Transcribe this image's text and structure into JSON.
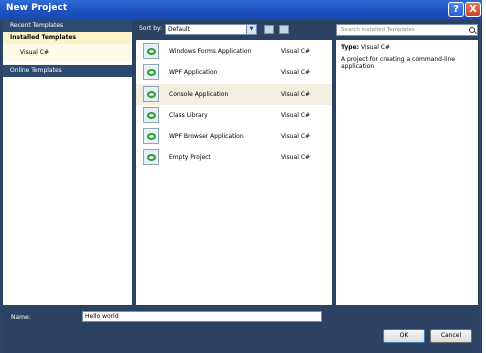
{
  "window": {
    "title": "New Project"
  },
  "left": {
    "recent": "Recent Templates",
    "installed": "Installed Templates",
    "language": "Visual C#",
    "online": "Online Templates"
  },
  "sort": {
    "label": "Sort by:",
    "selected": "Default"
  },
  "search": {
    "placeholder": "Search Installed Templates"
  },
  "templates": [
    {
      "name": "Windows Forms Application",
      "lang": "Visual C#"
    },
    {
      "name": "WPF Application",
      "lang": "Visual C#"
    },
    {
      "name": "Console Application",
      "lang": "Visual C#",
      "selected": true
    },
    {
      "name": "Class Library",
      "lang": "Visual C#"
    },
    {
      "name": "WPF Browser Application",
      "lang": "Visual C#"
    },
    {
      "name": "Empty Project",
      "lang": "Visual C#"
    }
  ],
  "details": {
    "type_label": "Type:",
    "type_value": "Visual C#",
    "description": "A project for creating a command-line application"
  },
  "name_field": {
    "label": "Name:",
    "value": "Hello world"
  },
  "buttons": {
    "ok": "OK",
    "cancel": "Cancel"
  },
  "icons": {
    "help": "?",
    "close": "X",
    "dropdown": "▼"
  }
}
